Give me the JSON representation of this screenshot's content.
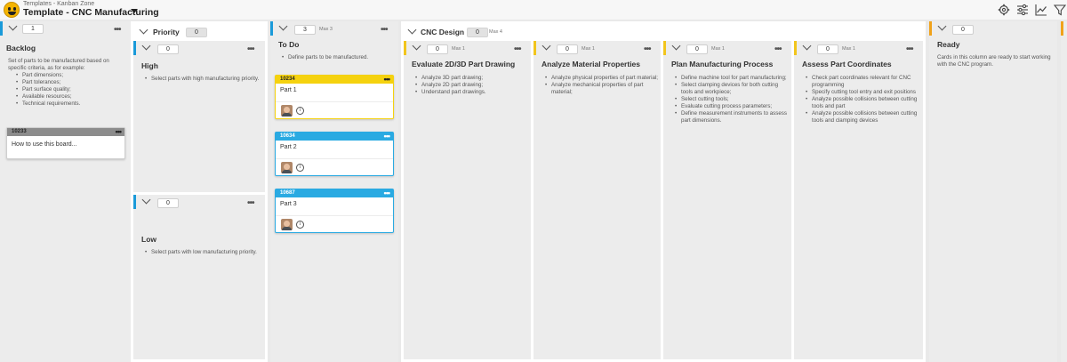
{
  "header": {
    "breadcrumb": "Templates - Kanban Zone",
    "title": "Template - CNC Manufacturing",
    "tools": [
      "gear-icon",
      "sliders-icon",
      "chart-line-icon",
      "filter-icon"
    ]
  },
  "colors": {
    "blue": "#1a9ad9",
    "yellow": "#f2c51c",
    "orange": "#f0a21a",
    "card_yellow": "#f5d20f",
    "card_blue": "#2aaae2",
    "card_grey": "#8c8c8c"
  },
  "columns": {
    "backlog": {
      "count": "1",
      "name": "Backlog",
      "desc_intro": "Set of parts to be manufactured based on specific criteria, as for example:",
      "bullets": [
        "Part dimensions;",
        "Part tolerances;",
        "Part surface quality;",
        "Available resources;",
        "Technical requirements."
      ],
      "card": {
        "id": "10233",
        "title": "How to use this board...",
        "menu": "•••"
      },
      "menu": "•••"
    },
    "priority": {
      "label": "Priority",
      "count": "0",
      "high": {
        "count": "0",
        "name": "High",
        "bullets": [
          "Select parts with high manufacturing priority."
        ],
        "menu": "•••"
      },
      "low": {
        "count": "0",
        "name": "Low",
        "bullets": [
          "Select parts with low manufacturing priority."
        ],
        "menu": "•••"
      }
    },
    "todo": {
      "count": "3",
      "max": "Max 3",
      "name": "To Do",
      "bullets": [
        "Define parts to be manufactured."
      ],
      "menu": "•••",
      "cards": [
        {
          "id": "10234",
          "title": "Part 1",
          "menu": "•••",
          "info": "i"
        },
        {
          "id": "10634",
          "title": "Part 2",
          "menu": "•••",
          "info": "i"
        },
        {
          "id": "10687",
          "title": "Part 3",
          "menu": "•••",
          "info": "i"
        }
      ]
    },
    "cnc": {
      "label": "CNC Design",
      "count": "0",
      "max": "Max 4",
      "subs": [
        {
          "count": "0",
          "max": "Max 1",
          "name": "Evaluate 2D/3D Part Drawing",
          "menu": "•••",
          "bullets": [
            "Analyze 3D part drawing;",
            "Analyze 2D part drawing;",
            "Understand part drawings."
          ]
        },
        {
          "count": "0",
          "max": "Max 1",
          "name": "Analyze Material Properties",
          "menu": "•••",
          "bullets": [
            "Analyze physical properties of part material;",
            "Analyze mechanical properties of part material;"
          ]
        },
        {
          "count": "0",
          "max": "Max 1",
          "name": "Plan Manufacturing Process",
          "menu": "•••",
          "bullets": [
            "Define machine tool for part manufacturing;",
            "Select clamping devices for both cutting tools and workpiece;",
            "Select cutting tools;",
            "Evaluate cutting process parameters;",
            "Define measurement instruments to assess part dimensions."
          ]
        },
        {
          "count": "0",
          "max": "Max 1",
          "name": "Assess Part Coordinates",
          "menu": "•••",
          "bullets": [
            "Check part coordinates relevant for CNC programming",
            "Specify cutting tool entry and exit positions",
            "Analyze possible collisions between cutting tools and part",
            "Analyze possible collisions between cutting tools and clamping devices"
          ]
        }
      ]
    },
    "ready": {
      "count": "0",
      "name": "Ready",
      "desc": "Cards in this column are ready to start working with the CNC program."
    }
  }
}
